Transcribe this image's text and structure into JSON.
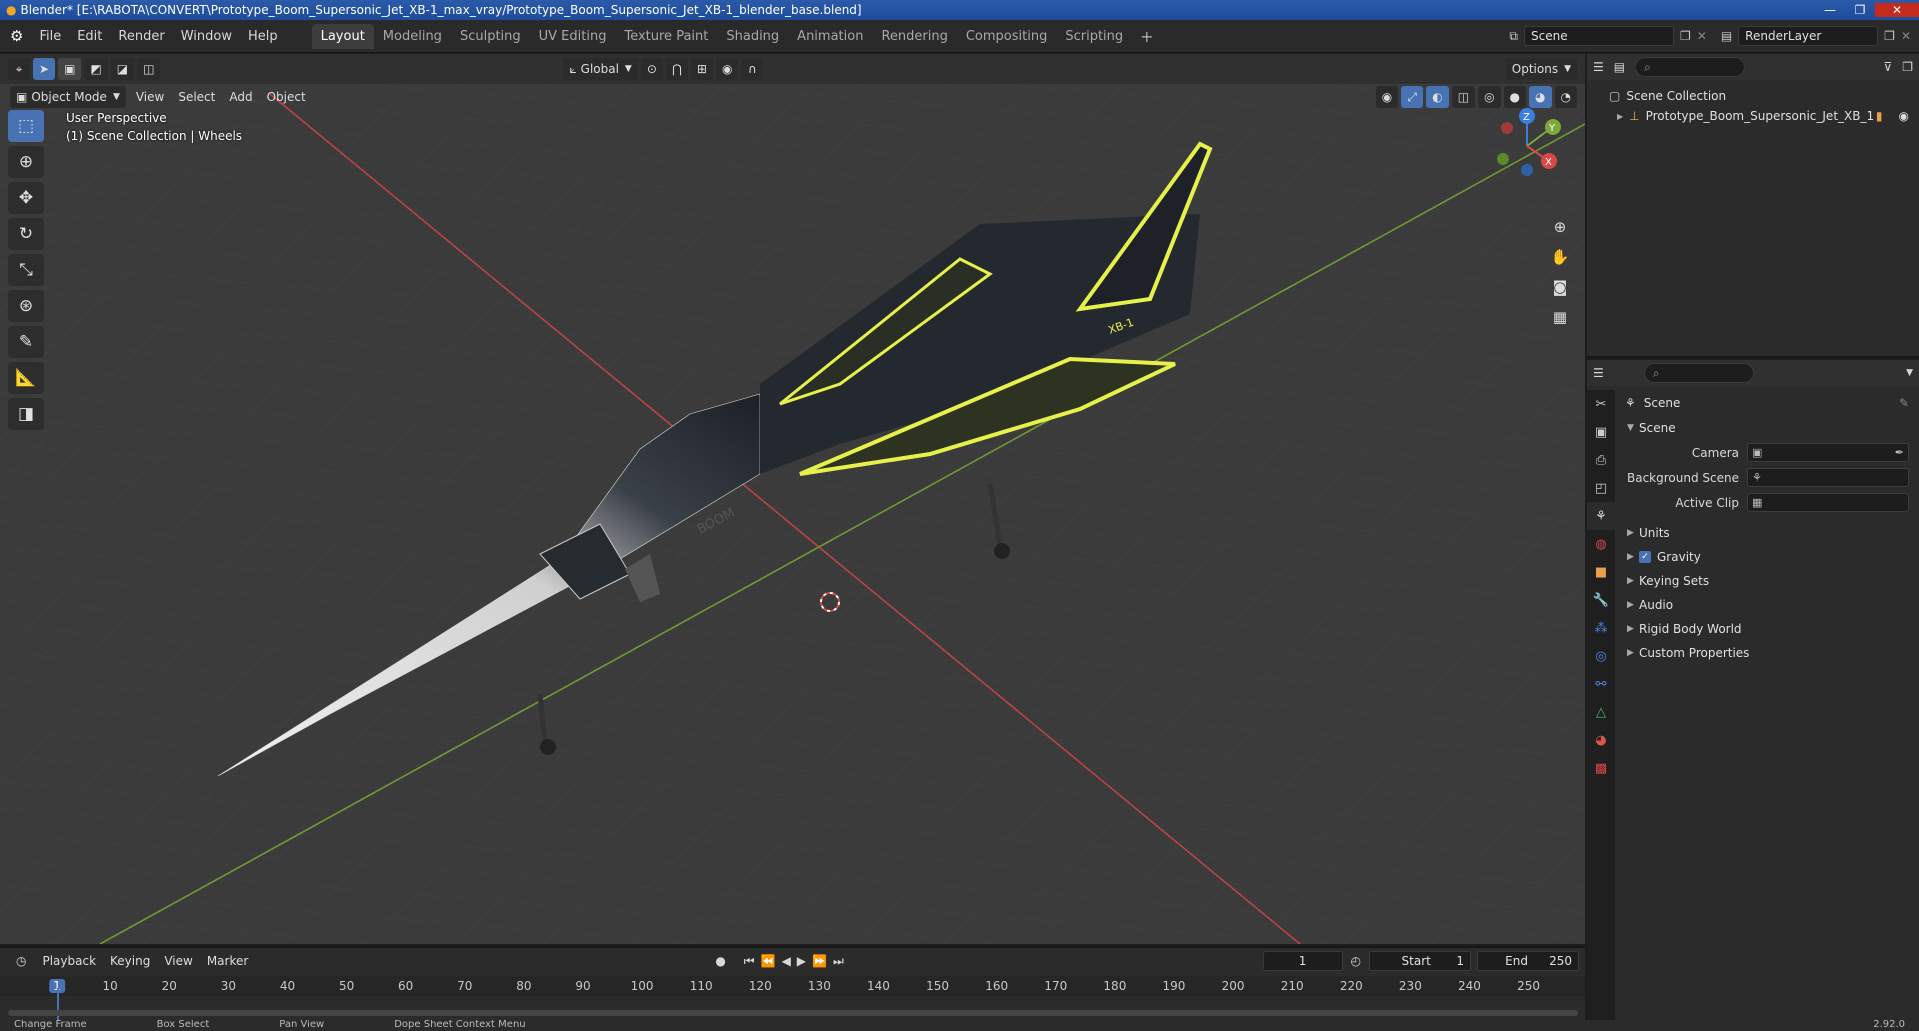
{
  "window": {
    "title": "Blender* [E:\\RABOTA\\CONVERT\\Prototype_Boom_Supersonic_Jet_XB-1_max_vray/Prototype_Boom_Supersonic_Jet_XB-1_blender_base.blend]",
    "minimize": "—",
    "maximize": "❐",
    "close": "✕"
  },
  "menubar": {
    "items": [
      "File",
      "Edit",
      "Render",
      "Window",
      "Help"
    ]
  },
  "workspaces": {
    "tabs": [
      "Layout",
      "Modeling",
      "Sculpting",
      "UV Editing",
      "Texture Paint",
      "Shading",
      "Animation",
      "Rendering",
      "Compositing",
      "Scripting"
    ],
    "active": "Layout",
    "add": "+"
  },
  "scene_selector": {
    "value": "Scene"
  },
  "renderlayer_selector": {
    "value": "RenderLayer"
  },
  "viewport": {
    "transform_orientation": "Global",
    "options_label": "Options",
    "mode": "Object Mode",
    "menus": [
      "View",
      "Select",
      "Add",
      "Object"
    ],
    "perspective_text": "User Perspective",
    "collection_text": "(1) Scene Collection | Wheels",
    "gizmo_axes": {
      "z": "Z",
      "y": "Y",
      "x": "X"
    },
    "aircraft_logo": "BOOM",
    "aircraft_tail_text": "XB-1",
    "colors": {
      "x_axis": "#d94747",
      "y_axis": "#7fa83a",
      "z_axis": "#3a7ee0",
      "accent_yellow": "#e8f04a"
    }
  },
  "outliner": {
    "scene_collection": "Scene Collection",
    "object_name": "Prototype_Boom_Supersonic_Jet_XB_1"
  },
  "properties": {
    "title": "Scene",
    "section": "Scene",
    "rows": [
      {
        "label": "Camera"
      },
      {
        "label": "Background Scene"
      },
      {
        "label": "Active Clip"
      }
    ],
    "collapsed_sections": [
      "Units",
      "Gravity",
      "Keying Sets",
      "Audio",
      "Rigid Body World",
      "Custom Properties"
    ]
  },
  "timeline": {
    "menus": [
      "Playback",
      "Keying",
      "View",
      "Marker"
    ],
    "current_frame": "1",
    "start_label": "Start",
    "start_value": "1",
    "end_label": "End",
    "end_value": "250",
    "ticks": [
      "1",
      "10",
      "20",
      "30",
      "40",
      "50",
      "60",
      "70",
      "80",
      "90",
      "100",
      "110",
      "120",
      "130",
      "140",
      "150",
      "160",
      "170",
      "180",
      "190",
      "200",
      "210",
      "220",
      "230",
      "240",
      "250"
    ]
  },
  "statusbar": {
    "items": [
      "Change Frame",
      "Box Select",
      "Pan View",
      "Dope Sheet Context Menu"
    ],
    "version": "2.92.0"
  }
}
